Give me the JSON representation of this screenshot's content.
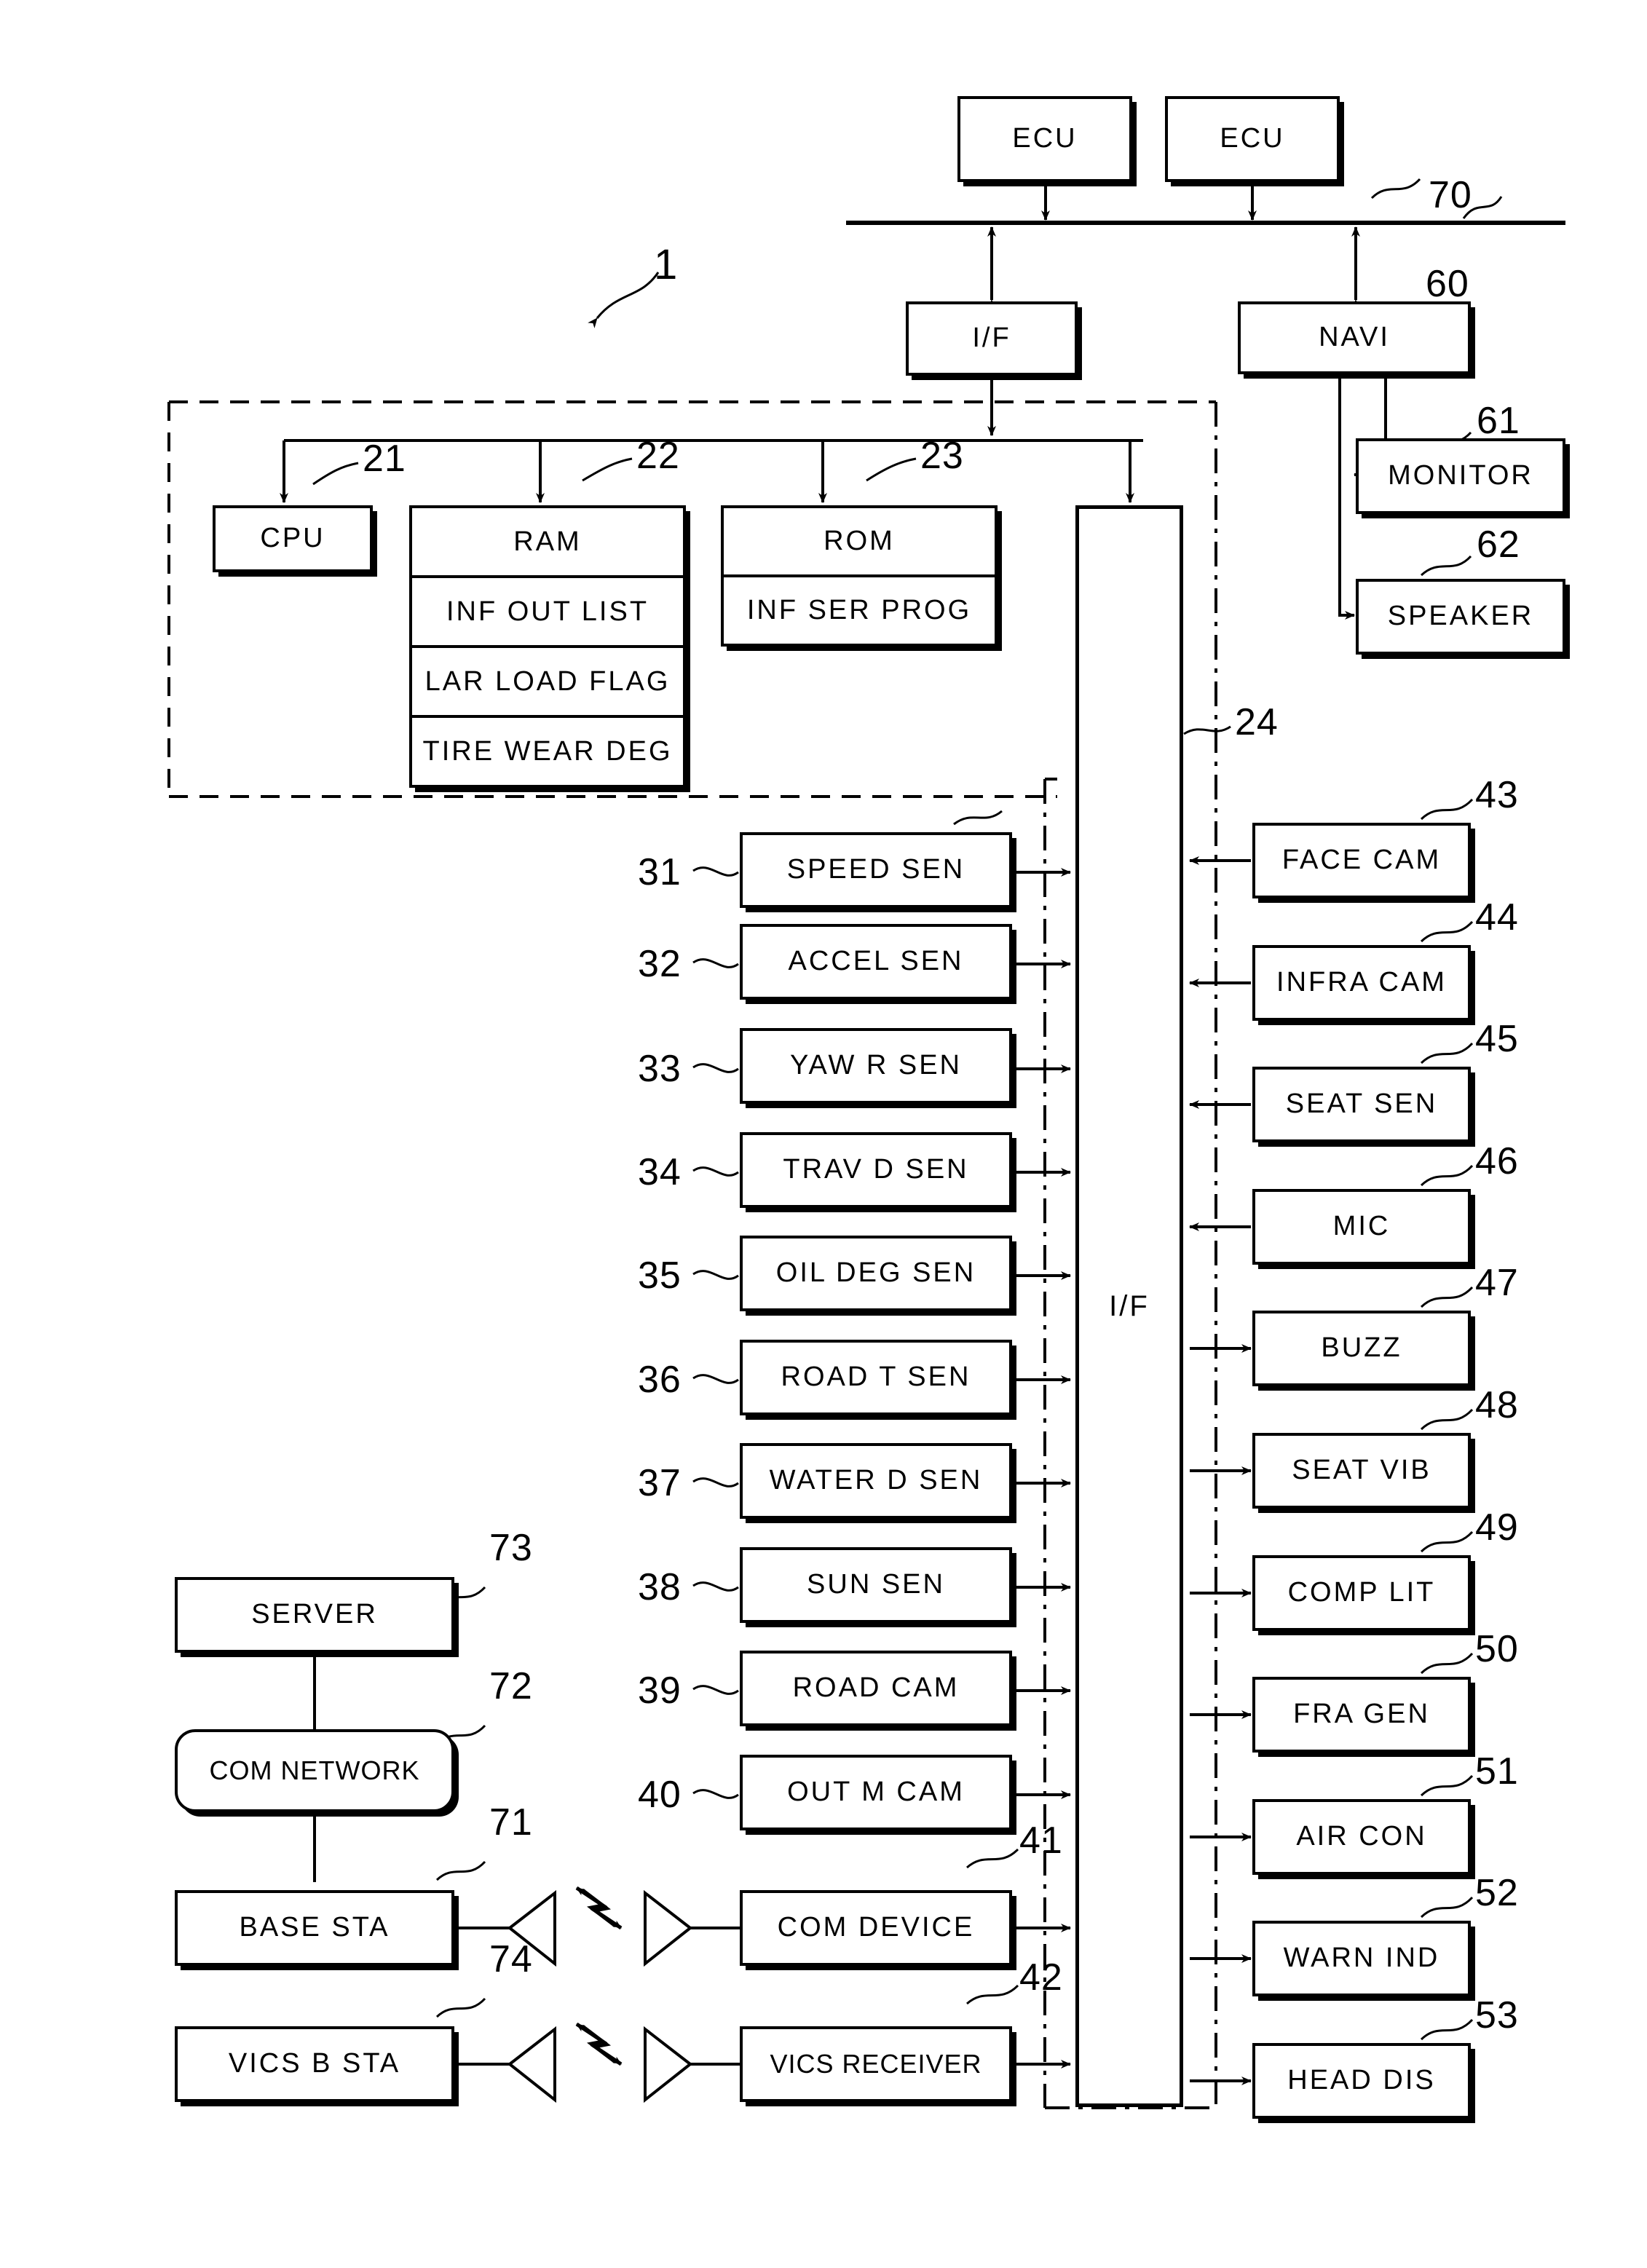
{
  "diagram": {
    "figure_reference": "1",
    "top_nodes": [
      {
        "id": "ecu-1",
        "label": "ECU"
      },
      {
        "id": "ecu-2",
        "label": "ECU"
      }
    ],
    "bus_label": "70",
    "interface_top": {
      "label": "I/F"
    },
    "navigation": {
      "label": "NAVI",
      "ref": "60",
      "outputs": [
        {
          "label": "MONITOR",
          "ref": "61"
        },
        {
          "label": "SPEAKER",
          "ref": "62"
        }
      ]
    },
    "controller": {
      "cpu": {
        "label": "CPU",
        "ref": "21"
      },
      "ram": {
        "label": "RAM",
        "ref": "22",
        "cells": [
          "INF OUT LIST",
          "LAR LOAD FLAG",
          "TIRE WEAR DEG"
        ]
      },
      "rom": {
        "label": "ROM",
        "ref": "23",
        "cells": [
          "INF SER PROG"
        ]
      },
      "interface_bus": {
        "label": "I/F",
        "ref": "24"
      }
    },
    "inputs": [
      {
        "ref": "31",
        "label": "SPEED SEN"
      },
      {
        "ref": "32",
        "label": "ACCEL SEN"
      },
      {
        "ref": "33",
        "label": "YAW R SEN"
      },
      {
        "ref": "34",
        "label": "TRAV D SEN"
      },
      {
        "ref": "35",
        "label": "OIL DEG SEN"
      },
      {
        "ref": "36",
        "label": "ROAD T SEN"
      },
      {
        "ref": "37",
        "label": "WATER D SEN"
      },
      {
        "ref": "38",
        "label": "SUN SEN"
      },
      {
        "ref": "39",
        "label": "ROAD CAM"
      },
      {
        "ref": "40",
        "label": "OUT M CAM"
      },
      {
        "ref": "41",
        "label": "COM DEVICE"
      },
      {
        "ref": "42",
        "label": "VICS RECEIVER"
      }
    ],
    "outputs": [
      {
        "ref": "43",
        "label": "FACE CAM",
        "dir": "in"
      },
      {
        "ref": "44",
        "label": "INFRA CAM",
        "dir": "in"
      },
      {
        "ref": "45",
        "label": "SEAT SEN",
        "dir": "in"
      },
      {
        "ref": "46",
        "label": "MIC",
        "dir": "in"
      },
      {
        "ref": "47",
        "label": "BUZZ",
        "dir": "out"
      },
      {
        "ref": "48",
        "label": "SEAT VIB",
        "dir": "out"
      },
      {
        "ref": "49",
        "label": "COMP LIT",
        "dir": "out"
      },
      {
        "ref": "50",
        "label": "FRA GEN",
        "dir": "out"
      },
      {
        "ref": "51",
        "label": "AIR CON",
        "dir": "out"
      },
      {
        "ref": "52",
        "label": "WARN IND",
        "dir": "out"
      },
      {
        "ref": "53",
        "label": "HEAD DIS",
        "dir": "out"
      }
    ],
    "network": [
      {
        "ref": "73",
        "label": "SERVER"
      },
      {
        "ref": "72",
        "label": "COM NETWORK"
      },
      {
        "ref": "71",
        "label": "BASE STA"
      },
      {
        "ref": "74",
        "label": "VICS B STA"
      }
    ]
  }
}
